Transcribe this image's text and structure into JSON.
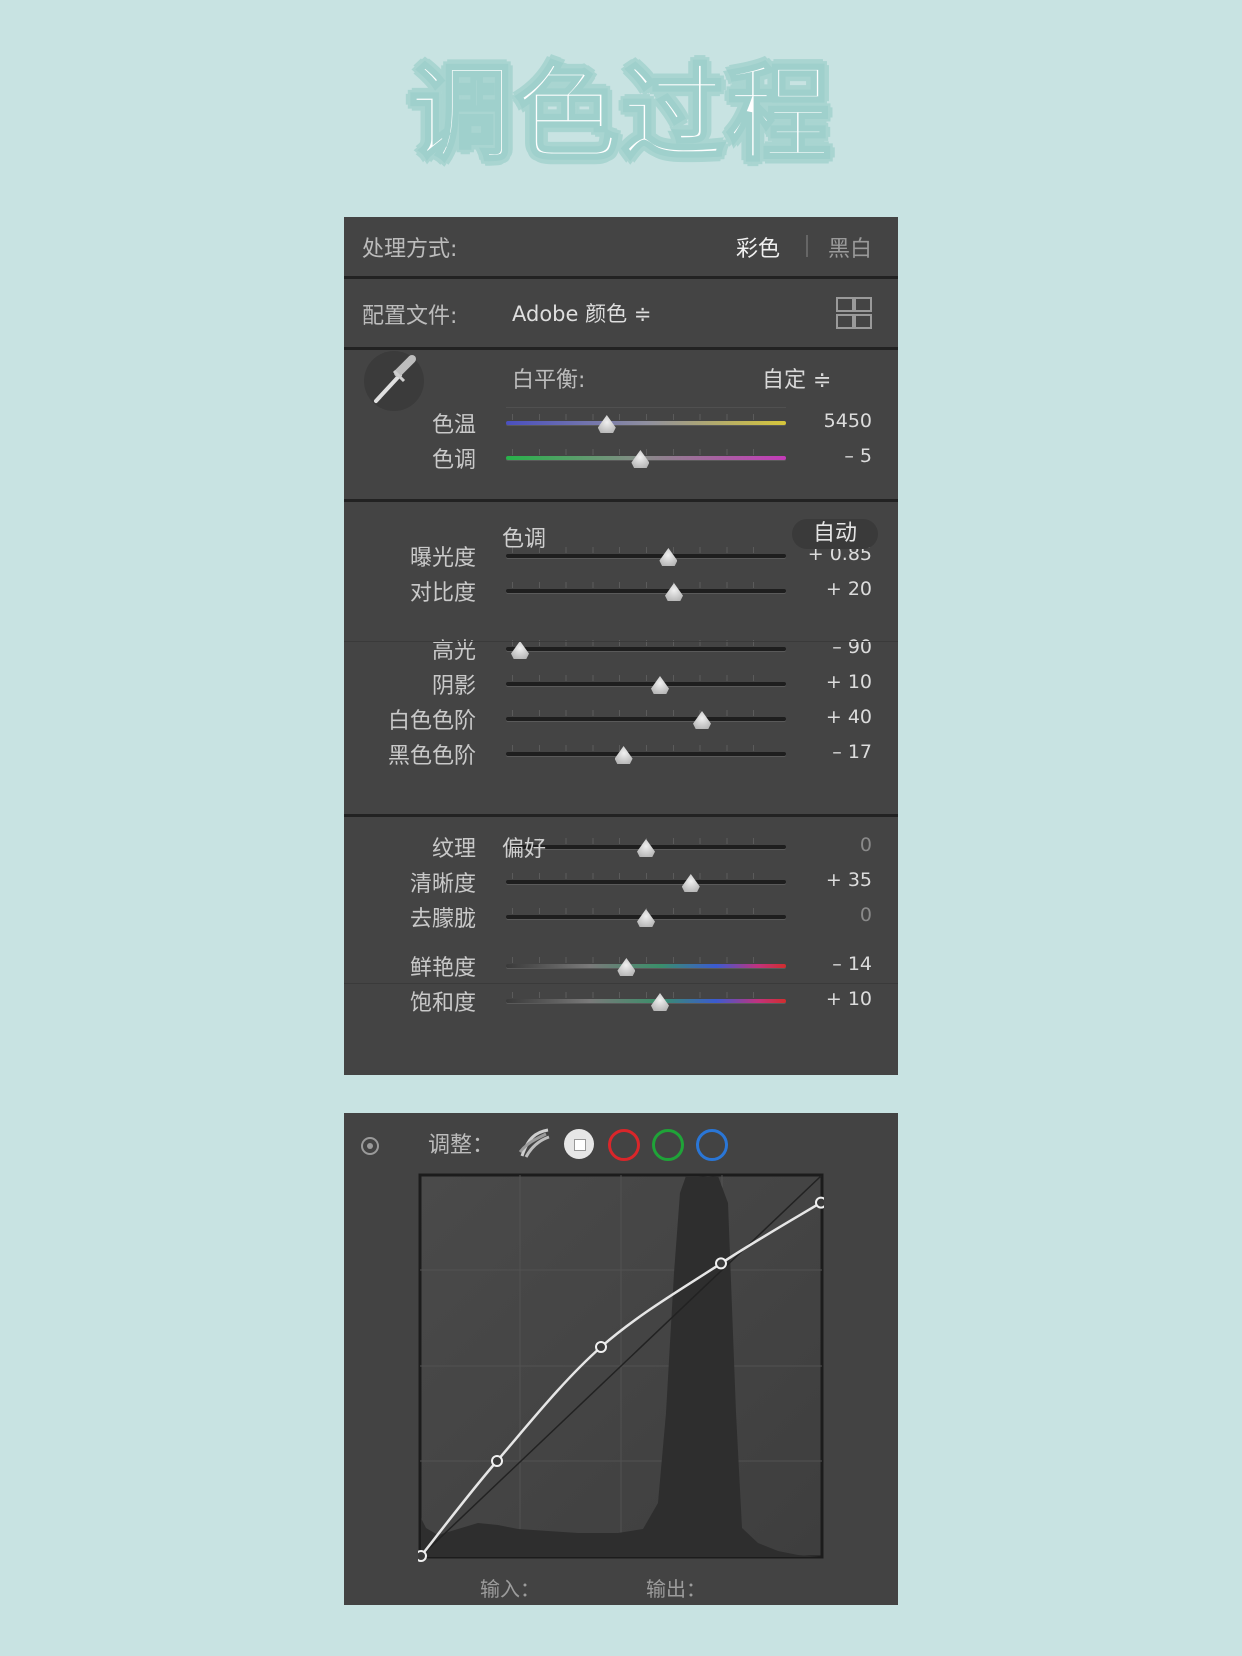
{
  "title": "调色过程",
  "basic": {
    "treatment_label": "处理方式:",
    "treatment_color": "彩色",
    "treatment_bw": "黑白",
    "profile_label": "配置文件:",
    "profile_value": "Adobe 颜色 ≑",
    "wb_label": "白平衡:",
    "wb_value": "自定 ≑",
    "tone_header": "色调",
    "auto_label": "自动",
    "presence_header": "偏好",
    "sliders": [
      {
        "label": "色温",
        "value": "5450",
        "level": 0.36,
        "track": "temp"
      },
      {
        "label": "色调",
        "value": "– 5",
        "level": 0.48,
        "track": "tint"
      },
      {
        "label": "曝光度",
        "value": "+ 0.85",
        "level": 0.58,
        "track": "plain"
      },
      {
        "label": "对比度",
        "value": "+ 20",
        "level": 0.6,
        "track": "plain"
      },
      {
        "label": "高光",
        "value": "– 90",
        "level": 0.05,
        "track": "plain"
      },
      {
        "label": "阴影",
        "value": "+ 10",
        "level": 0.55,
        "track": "plain"
      },
      {
        "label": "白色色阶",
        "value": "+ 40",
        "level": 0.7,
        "track": "plain"
      },
      {
        "label": "黑色色阶",
        "value": "– 17",
        "level": 0.42,
        "track": "plain"
      },
      {
        "label": "纹理",
        "value": "0",
        "level": 0.5,
        "track": "plain",
        "dim": true
      },
      {
        "label": "清晰度",
        "value": "+ 35",
        "level": 0.66,
        "track": "plain"
      },
      {
        "label": "去朦胧",
        "value": "0",
        "level": 0.5,
        "track": "plain",
        "dim": true
      },
      {
        "label": "鲜艳度",
        "value": "– 14",
        "level": 0.43,
        "track": "vibrance"
      },
      {
        "label": "饱和度",
        "value": "+ 10",
        "level": 0.55,
        "track": "saturation"
      }
    ]
  },
  "curve": {
    "adjust_label": "调整：",
    "input_label": "输入：",
    "output_label": "输出：",
    "points": [
      [
        0,
        0
      ],
      [
        0.19,
        0.25
      ],
      [
        0.45,
        0.55
      ],
      [
        0.75,
        0.77
      ],
      [
        1.0,
        0.93
      ]
    ]
  },
  "colors": {
    "background": "#c8e3e2",
    "panel": "#444444",
    "red_channel": "#d9262a",
    "green_channel": "#1fa338",
    "blue_channel": "#2a76d6"
  }
}
